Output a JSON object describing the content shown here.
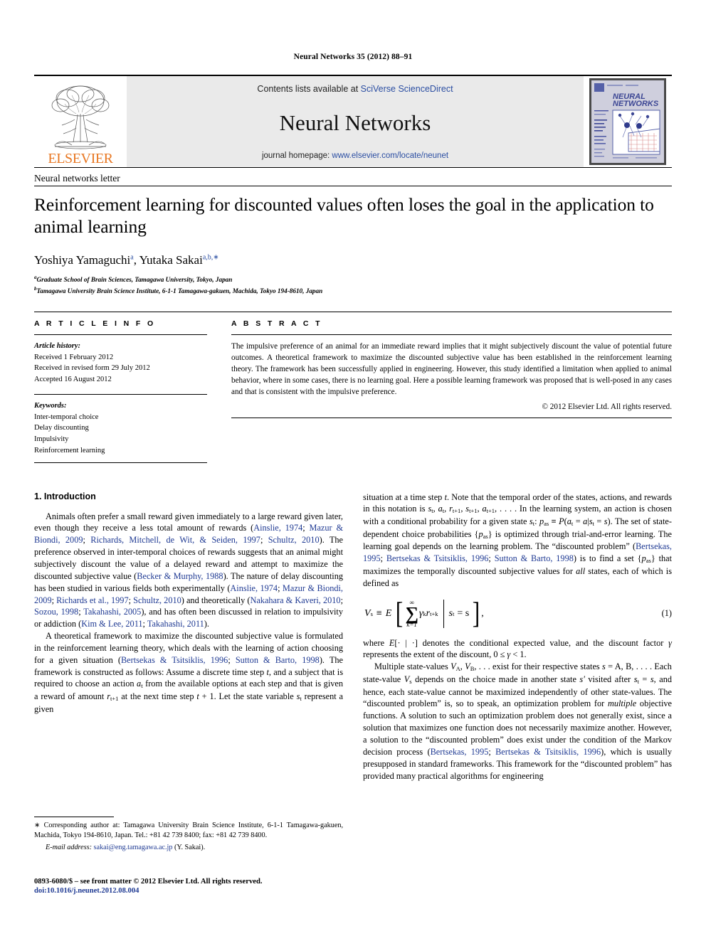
{
  "running_head": "Neural Networks 35 (2012) 88–91",
  "masthead": {
    "contents_prefix": "Contents lists available at ",
    "contents_link": "SciVerse ScienceDirect",
    "journal_name": "Neural Networks",
    "homepage_prefix": "journal homepage: ",
    "homepage_link": "www.elsevier.com/locate/neunet",
    "publisher_wordmark": "ELSEVIER",
    "cover_title_line1": "NEURAL",
    "cover_title_line2": "NETWORKS",
    "link_color": "#2b4ea2",
    "brand_orange": "#e87722"
  },
  "article": {
    "type": "Neural networks letter",
    "title": "Reinforcement learning for discounted values often loses the goal in the application to animal learning",
    "authors": "Yoshiya Yamaguchi",
    "author1_sup": "a",
    "authors2": ", Yutaka Sakai",
    "author2_sup": "a,b,∗",
    "affiliations": [
      {
        "marker": "a",
        "text": "Graduate School of Brain Sciences, Tamagawa University, Tokyo, Japan"
      },
      {
        "marker": "b",
        "text": "Tamagawa University Brain Science Institute, 6-1-1 Tamagawa-gakuen, Machida, Tokyo 194-8610, Japan"
      }
    ]
  },
  "info": {
    "heading": "A R T I C L E    I N F O",
    "history_label": "Article history:",
    "history": [
      "Received 1 February 2012",
      "Received in revised form 29 July 2012",
      "Accepted 16 August 2012"
    ],
    "keywords_label": "Keywords:",
    "keywords": [
      "Inter-temporal choice",
      "Delay discounting",
      "Impulsivity",
      "Reinforcement learning"
    ]
  },
  "abstract": {
    "heading": "A B S T R A C T",
    "text": "The impulsive preference of an animal for an immediate reward implies that it might subjectively discount the value of potential future outcomes. A theoretical framework to maximize the discounted subjective value has been established in the reinforcement learning theory. The framework has been successfully applied in engineering. However, this study identified a limitation when applied to animal behavior, where in some cases, there is no learning goal. Here a possible learning framework was proposed that is well-posed in any cases and that is consistent with the impulsive preference.",
    "copyright": "© 2012 Elsevier Ltd. All rights reserved."
  },
  "body": {
    "section_number_title": "1. Introduction",
    "left_paragraphs": [
      {
        "runs": [
          {
            "t": "Animals often prefer a small reward given immediately to a large reward given later, even though they receive a less total amount of rewards ("
          },
          {
            "t": "Ainslie, 1974",
            "cite": true
          },
          {
            "t": "; "
          },
          {
            "t": "Mazur & Biondi, 2009",
            "cite": true
          },
          {
            "t": "; "
          },
          {
            "t": "Richards, Mitchell, de Wit, & Seiden, 1997",
            "cite": true
          },
          {
            "t": "; "
          },
          {
            "t": "Schultz, 2010",
            "cite": true
          },
          {
            "t": "). The preference observed in inter-temporal choices of rewards suggests that an animal might subjectively discount the value of a delayed reward and attempt to maximize the discounted subjective value ("
          },
          {
            "t": "Becker & Murphy, 1988",
            "cite": true
          },
          {
            "t": "). The nature of delay discounting has been studied in various fields both experimentally ("
          },
          {
            "t": "Ainslie, 1974",
            "cite": true
          },
          {
            "t": "; "
          },
          {
            "t": "Mazur & Biondi, 2009",
            "cite": true
          },
          {
            "t": "; "
          },
          {
            "t": "Richards et al., 1997",
            "cite": true
          },
          {
            "t": "; "
          },
          {
            "t": "Schultz, 2010",
            "cite": true
          },
          {
            "t": ") and theoretically ("
          },
          {
            "t": "Nakahara & Kaveri, 2010",
            "cite": true
          },
          {
            "t": "; "
          },
          {
            "t": "Sozou, 1998",
            "cite": true
          },
          {
            "t": "; "
          },
          {
            "t": "Takahashi, 2005",
            "cite": true
          },
          {
            "t": "), and has often been discussed in relation to impulsivity or addiction ("
          },
          {
            "t": "Kim & Lee, 2011",
            "cite": true
          },
          {
            "t": "; "
          },
          {
            "t": "Takahashi, 2011",
            "cite": true
          },
          {
            "t": ")."
          }
        ]
      },
      {
        "runs": [
          {
            "t": "A theoretical framework to maximize the discounted subjective value is formulated in the reinforcement learning theory, which deals with the learning of action choosing for a given situation ("
          },
          {
            "t": "Bertsekas & Tsitsiklis, 1996",
            "cite": true
          },
          {
            "t": "; "
          },
          {
            "t": "Sutton & Barto, 1998",
            "cite": true
          },
          {
            "t": "). The framework is constructed as follows: Assume a discrete time step "
          },
          {
            "t": "t",
            "italic": true
          },
          {
            "t": ", and a subject that is required to choose an action "
          },
          {
            "t": "a",
            "italic": true
          },
          {
            "t": "t",
            "sub": true
          },
          {
            "t": " from the available options at each step and that is given a reward of amount "
          },
          {
            "t": "r",
            "italic": true
          },
          {
            "t": "t+1",
            "sub": true
          },
          {
            "t": " at the next time step "
          },
          {
            "t": "t",
            "italic": true
          },
          {
            "t": " + 1. Let the state variable "
          },
          {
            "t": "s",
            "italic": true
          },
          {
            "t": "t",
            "sub": true
          },
          {
            "t": " represent a given"
          }
        ]
      }
    ],
    "right_paragraphs_before_eq": [
      {
        "noindent": true,
        "runs": [
          {
            "t": "situation at a time step "
          },
          {
            "t": "t",
            "italic": true
          },
          {
            "t": ". Note that the temporal order of the states, actions, and rewards in this notation is "
          },
          {
            "t": "s",
            "italic": true
          },
          {
            "t": "t",
            "sub": true
          },
          {
            "t": ", "
          },
          {
            "t": "a",
            "italic": true
          },
          {
            "t": "t",
            "sub": true
          },
          {
            "t": ", "
          },
          {
            "t": "r",
            "italic": true
          },
          {
            "t": "t+1",
            "sub": true
          },
          {
            "t": ", "
          },
          {
            "t": "s",
            "italic": true
          },
          {
            "t": "t+1",
            "sub": true
          },
          {
            "t": ", "
          },
          {
            "t": "a",
            "italic": true
          },
          {
            "t": "t+1",
            "sub": true
          },
          {
            "t": ", . . . . In the learning system, an action is chosen with a conditional probability for a given state "
          },
          {
            "t": "s",
            "italic": true
          },
          {
            "t": "t",
            "sub": true
          },
          {
            "t": ": "
          },
          {
            "t": "p",
            "italic": true
          },
          {
            "t": "as",
            "sub": true
          },
          {
            "t": " ≡ "
          },
          {
            "t": "P",
            "italic": true
          },
          {
            "t": "("
          },
          {
            "t": "a",
            "italic": true
          },
          {
            "t": "t",
            "sub": true
          },
          {
            "t": " = "
          },
          {
            "t": "a",
            "italic": true
          },
          {
            "t": "|"
          },
          {
            "t": "s",
            "italic": true
          },
          {
            "t": "t",
            "sub": true
          },
          {
            "t": " = "
          },
          {
            "t": "s",
            "italic": true
          },
          {
            "t": "). The set of state-dependent choice probabilities {"
          },
          {
            "t": "p",
            "italic": true
          },
          {
            "t": "as",
            "sub": true
          },
          {
            "t": "} is optimized through trial-and-error learning. The learning goal depends on the learning problem. The “discounted problem” ("
          },
          {
            "t": "Bertsekas, 1995",
            "cite": true
          },
          {
            "t": "; "
          },
          {
            "t": "Bertsekas & Tsitsiklis, 1996",
            "cite": true
          },
          {
            "t": "; "
          },
          {
            "t": "Sutton & Barto, 1998",
            "cite": true
          },
          {
            "t": ") is to find a set {"
          },
          {
            "t": "p",
            "italic": true
          },
          {
            "t": "as",
            "sub": true
          },
          {
            "t": "} that maximizes the temporally discounted subjective values for "
          },
          {
            "t": "all",
            "italic": true
          },
          {
            "t": " states, each of which is defined as"
          }
        ]
      }
    ],
    "equation": {
      "lhs": "V",
      "lhs_sub": "s",
      "equiv": "≡",
      "expectation": "E",
      "sum_top": "∞",
      "sum_sym": "∑",
      "sum_bot": "k=1",
      "gamma": "γ",
      "gamma_sup": "k",
      "reward": "r",
      "reward_sub": "t+k",
      "cond_state": "s",
      "cond_state_sub": "t",
      "cond_eq": "= s",
      "trailing": ",",
      "number": "(1)"
    },
    "right_paragraphs_after_eq": [
      {
        "noindent": true,
        "runs": [
          {
            "t": "where "
          },
          {
            "t": "E",
            "italic": true
          },
          {
            "t": "[· | ·] denotes the conditional expected value, and the discount factor "
          },
          {
            "t": "γ",
            "italic": true
          },
          {
            "t": " represents the extent of the discount, 0 ≤ "
          },
          {
            "t": "γ",
            "italic": true
          },
          {
            "t": " < 1."
          }
        ]
      },
      {
        "runs": [
          {
            "t": "Multiple state-values "
          },
          {
            "t": "V",
            "italic": true
          },
          {
            "t": "A",
            "sub": true
          },
          {
            "t": ", "
          },
          {
            "t": "V",
            "italic": true
          },
          {
            "t": "B",
            "sub": true
          },
          {
            "t": ", . . . exist for their respective states "
          },
          {
            "t": "s",
            "italic": true
          },
          {
            "t": " = A, B, . . . . Each state-value "
          },
          {
            "t": "V",
            "italic": true
          },
          {
            "t": "s",
            "sub": true
          },
          {
            "t": " depends on the choice made in another state "
          },
          {
            "t": "s′",
            "italic": true
          },
          {
            "t": " visited after "
          },
          {
            "t": "s",
            "italic": true
          },
          {
            "t": "t",
            "sub": true
          },
          {
            "t": " = "
          },
          {
            "t": "s",
            "italic": true
          },
          {
            "t": ", and hence, each state-value cannot be maximized independently of other state-values. The “discounted problem” is, so to speak, an optimization problem for "
          },
          {
            "t": "multiple",
            "italic": true
          },
          {
            "t": " objective functions. A solution to such an optimization problem does not generally exist, since a solution that maximizes one function does not necessarily maximize another. However, a solution to the “discounted problem” does exist under the condition of the Markov decision process ("
          },
          {
            "t": "Bertsekas, 1995",
            "cite": true
          },
          {
            "t": "; "
          },
          {
            "t": "Bertsekas & Tsitsiklis, 1996",
            "cite": true
          },
          {
            "t": "), which is usually presupposed in standard frameworks. This framework for the “discounted problem” has provided many practical algorithms for engineering"
          }
        ]
      }
    ]
  },
  "footnotes": {
    "corresponding": "∗ Corresponding author at: Tamagawa University Brain Science Institute, 6-1-1 Tamagawa-gakuen, Machida, Tokyo 194-8610, Japan. Tel.: +81 42 739 8400; fax: +81 42 739 8400.",
    "email_label": "E-mail address:",
    "email": "sakai@eng.tamagawa.ac.jp",
    "email_suffix": "(Y. Sakai)."
  },
  "footer": {
    "issn_line": "0893-6080/$ – see front matter © 2012 Elsevier Ltd. All rights reserved.",
    "doi": "doi:10.1016/j.neunet.2012.08.004"
  }
}
